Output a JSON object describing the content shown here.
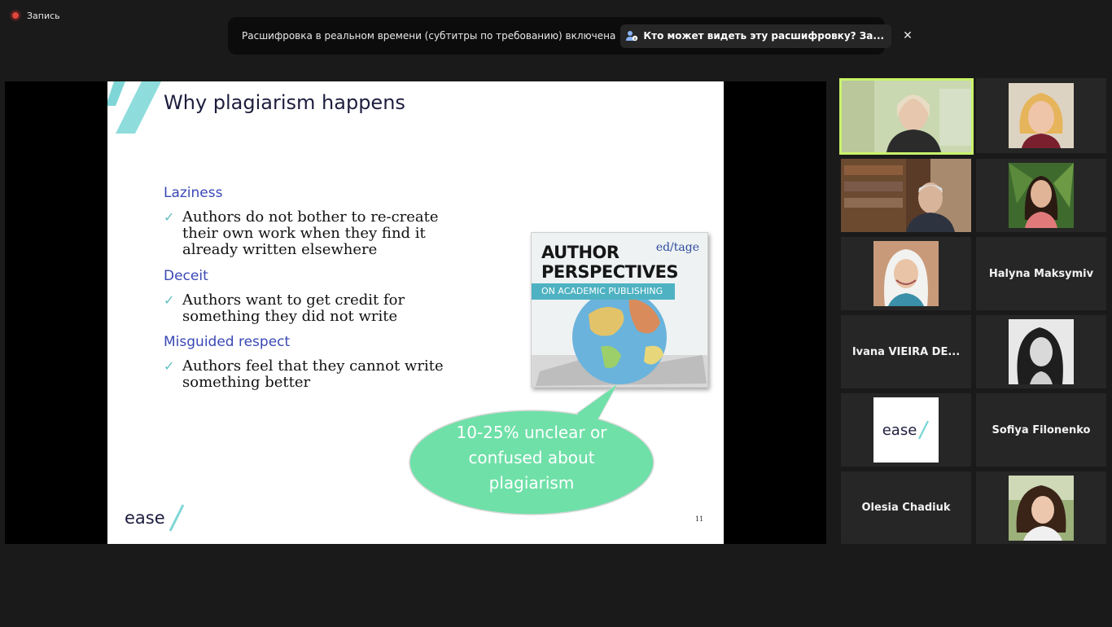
{
  "recording": {
    "label": "Запись"
  },
  "banner": {
    "text": "Расшифровка в реальном времени (субтитры по требованию) включена",
    "link": "Кто может видеть эту расшифровку? За...",
    "close": "✕"
  },
  "slide": {
    "title": "Why plagiarism happens",
    "sections": [
      {
        "heading": "Laziness",
        "bullets": [
          "Authors do not bother to re-create their own work when they find it already written elsewhere"
        ]
      },
      {
        "heading": "Deceit",
        "bullets": [
          "Authors want to get credit for something they did not write"
        ]
      },
      {
        "heading": "Misguided respect",
        "bullets": [
          "Authors feel that they cannot write something better"
        ]
      }
    ],
    "check": "✓",
    "book": {
      "title_line1": "AUTHOR",
      "title_line2": "PERSPECTIVES",
      "subtitle": "ON ACADEMIC PUBLISHING",
      "brand": "ed/tage"
    },
    "callout": {
      "line1": "10-25% unclear or",
      "line2": "confused about",
      "line3": "plagiarism"
    },
    "logo": "ease",
    "page_number": "11"
  },
  "participants": [
    {
      "type": "video"
    },
    {
      "type": "video"
    },
    {
      "type": "video"
    },
    {
      "type": "video"
    },
    {
      "type": "video"
    },
    {
      "type": "name",
      "name": "Halyna Maksymiv"
    },
    {
      "type": "name",
      "name": "Ivana VIEIRA DE..."
    },
    {
      "type": "video"
    },
    {
      "type": "logo",
      "logo": "ease"
    },
    {
      "type": "name",
      "name": "Sofiya Filonenko"
    },
    {
      "type": "name",
      "name": "Olesia Chadiuk"
    },
    {
      "type": "video"
    }
  ],
  "colors": {
    "active_speaker_border": "#c9f36b",
    "callout": "#6fe0a8",
    "section_heading": "#3a48b5",
    "teal": "#7fd6d6"
  }
}
